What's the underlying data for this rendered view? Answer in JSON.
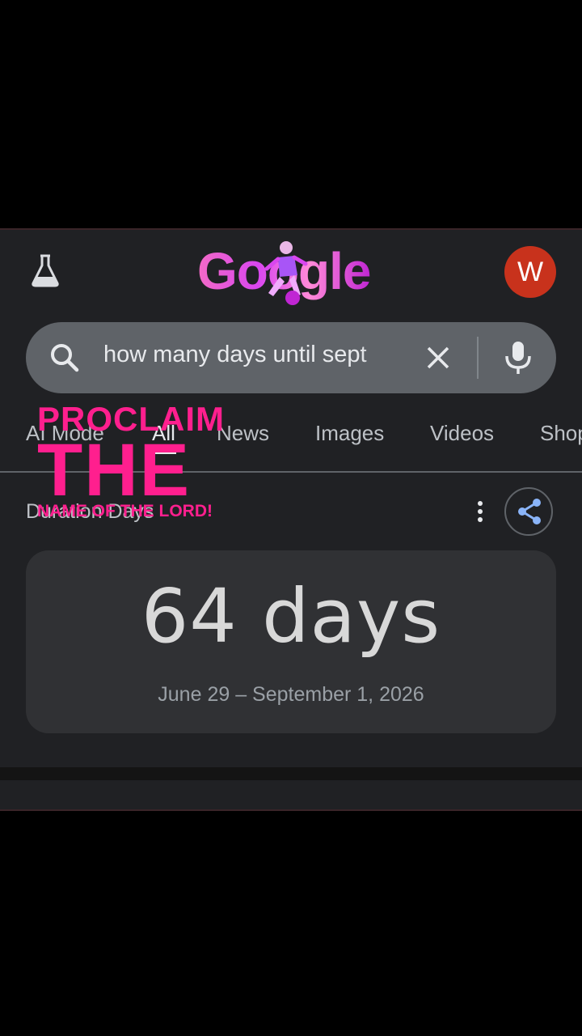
{
  "header": {
    "labs_icon": "flask-icon",
    "logo_text": "Google",
    "avatar_letter": "W",
    "avatar_color": "#c8321c"
  },
  "search": {
    "query": "how many days until sept",
    "icon": "search-icon",
    "clear_icon": "close-icon",
    "mic_icon": "mic-icon"
  },
  "tabs": [
    {
      "label": "AI Mode"
    },
    {
      "label": "All",
      "active": true
    },
    {
      "label": "News"
    },
    {
      "label": "Images"
    },
    {
      "label": "Videos"
    },
    {
      "label": "Shop"
    }
  ],
  "section": {
    "label": "Duration Days",
    "more_icon": "more-vert-icon",
    "share_icon": "share-icon"
  },
  "result": {
    "value": "64 days",
    "range": "June 29 – September 1, 2026"
  },
  "overlay": {
    "line1": "PROCLAIM",
    "line2": "THE",
    "line3": "NAME OF THE LORD!",
    "color": "#ff1f8e"
  }
}
